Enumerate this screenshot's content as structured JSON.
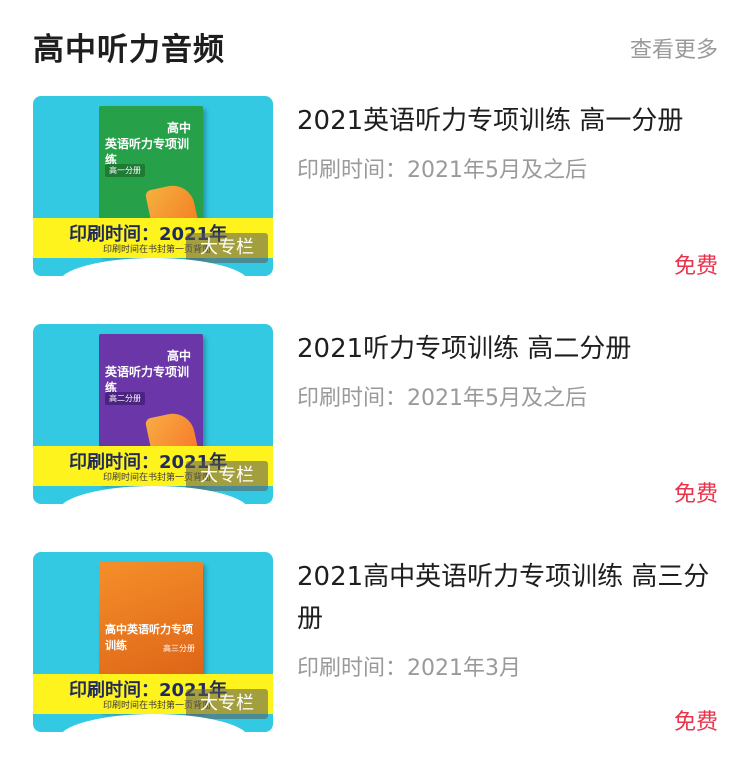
{
  "header": {
    "title": "高中听力音频",
    "more": "查看更多"
  },
  "items": [
    {
      "title": "2021英语听力专项训练 高一分册",
      "date": "印刷时间：2021年5月及之后",
      "price": "免费",
      "badge": "大专栏",
      "cover": {
        "book_small": "高中",
        "book_big": "英语听力专项训练",
        "book_vol": "高一分册",
        "band_main": "印刷时间：2021年",
        "band_sub": "印刷时间在书封第一页背面",
        "book_color": "#27a04a"
      }
    },
    {
      "title": "2021听力专项训练 高二分册",
      "date": "印刷时间：2021年5月及之后",
      "price": "免费",
      "badge": "大专栏",
      "cover": {
        "book_small": "高中",
        "book_big": "英语听力专项训练",
        "book_vol": "高二分册",
        "band_main": "印刷时间：2021年",
        "band_sub": "印刷时间在书封第一页背面",
        "book_color": "#6a36a8"
      }
    },
    {
      "title": "2021高中英语听力专项训练 高三分册",
      "date": "印刷时间：2021年3月",
      "price": "免费",
      "badge": "大专栏",
      "cover": {
        "book_small": "",
        "book_big": "高中英语听力专项训练",
        "book_vol": "高三分册",
        "band_main": "印刷时间：2021年",
        "band_sub": "印刷时间在书封第一页背面",
        "book_color": "#ef7d1a"
      }
    }
  ],
  "colors": {
    "cover_bg": "#33c9e3",
    "band": "#fff31d",
    "price": "#e8334a",
    "muted": "#9a9a9a"
  }
}
